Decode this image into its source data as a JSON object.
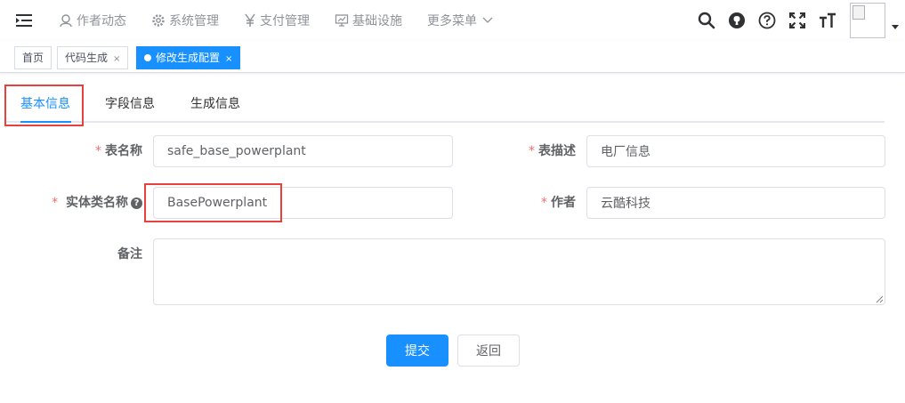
{
  "header": {
    "menu": [
      {
        "label": "作者动态",
        "icon": "user-icon"
      },
      {
        "label": "系统管理",
        "icon": "gear-icon"
      },
      {
        "label": "支付管理",
        "icon": "yen-icon"
      },
      {
        "label": "基础设施",
        "icon": "monitor-icon"
      },
      {
        "label": "更多菜单",
        "icon": "chevron-down-icon"
      }
    ],
    "tools": [
      "search-icon",
      "github-icon",
      "question-icon",
      "fullscreen-icon",
      "font-size-icon"
    ]
  },
  "tags": [
    {
      "label": "首页",
      "close": ""
    },
    {
      "label": "代码生成",
      "close": "×"
    },
    {
      "label": "修改生成配置",
      "close": "×"
    }
  ],
  "tabs": [
    "基本信息",
    "字段信息",
    "生成信息"
  ],
  "form": {
    "required_mark": "*",
    "table_name": {
      "label": "表名称",
      "value": "safe_base_powerplant"
    },
    "table_comment": {
      "label": "表描述",
      "value": "电厂信息"
    },
    "class_name": {
      "label": "实体类名称",
      "value": "BasePowerplant",
      "help": "?"
    },
    "author": {
      "label": "作者",
      "value": "云酷科技"
    },
    "remark": {
      "label": "备注",
      "value": ""
    }
  },
  "buttons": {
    "submit": "提交",
    "back": "返回"
  },
  "colors": {
    "primary": "#1890ff",
    "highlight": "#e8403d",
    "required": "#f56c6c"
  }
}
